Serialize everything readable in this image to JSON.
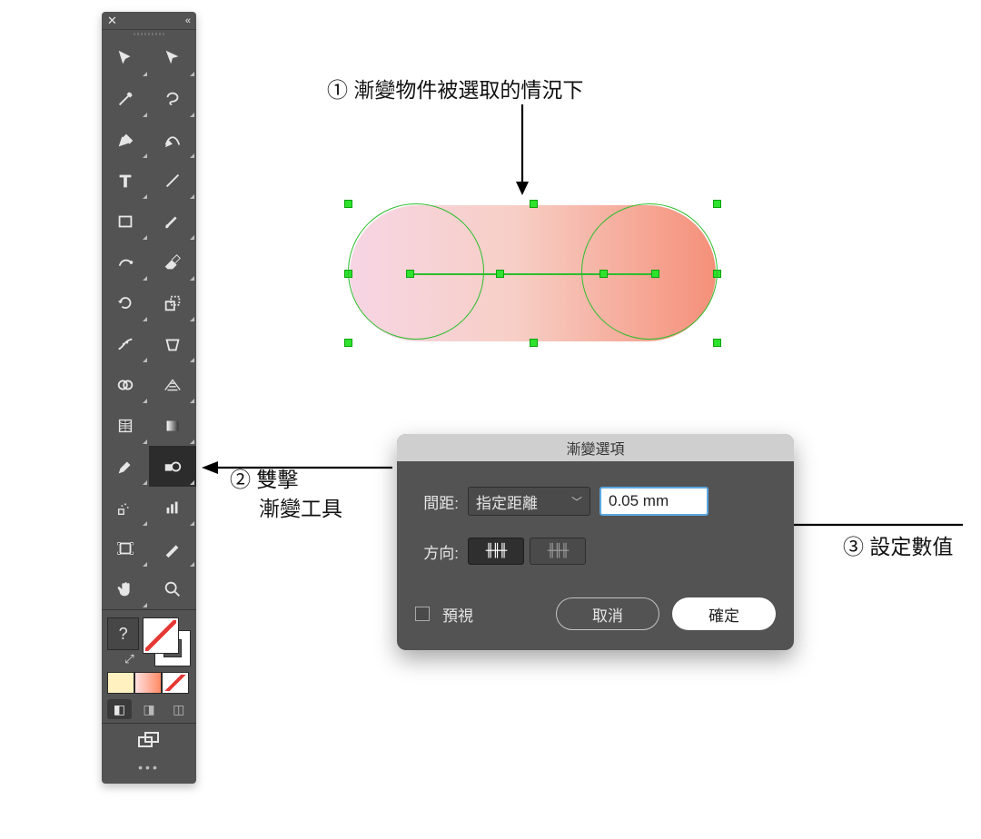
{
  "annotations": {
    "step1": "① 漸變物件被選取的情況下",
    "step2a": "② 雙擊",
    "step2b": "漸變工具",
    "step3": "③ 設定數值"
  },
  "tools_panel": {
    "left_column": [
      "selection-tool",
      "magic-wand-tool",
      "pen-tool",
      "type-tool",
      "rectangle-tool",
      "curvature-tool",
      "rotate-tool",
      "width-tool",
      "shape-builder-tool",
      "mesh-tool",
      "eyedropper-tool",
      "artboard-tool",
      "slice-tool",
      "hand-tool"
    ],
    "right_column": [
      "direct-selection-tool",
      "lasso-tool",
      "add-anchor-tool",
      "line-tool",
      "paintbrush-tool",
      "eraser-tool",
      "scale-tool",
      "free-transform-tool",
      "perspective-grid-tool",
      "gradient-tool",
      "blend-tool",
      "column-graph-tool",
      "knife-tool",
      "zoom-tool"
    ],
    "selected_tool": "blend-tool",
    "fill_stroke_help": "?"
  },
  "dialog": {
    "title": "漸變選項",
    "spacing_label": "間距:",
    "spacing_mode": "指定距離",
    "spacing_value": "0.05 mm",
    "orientation_label": "方向:",
    "orientation_icons": {
      "align_page": "╫╫╫",
      "align_path": "╫╫╫"
    },
    "preview_label": "預視",
    "cancel_label": "取消",
    "ok_label": "確定"
  }
}
